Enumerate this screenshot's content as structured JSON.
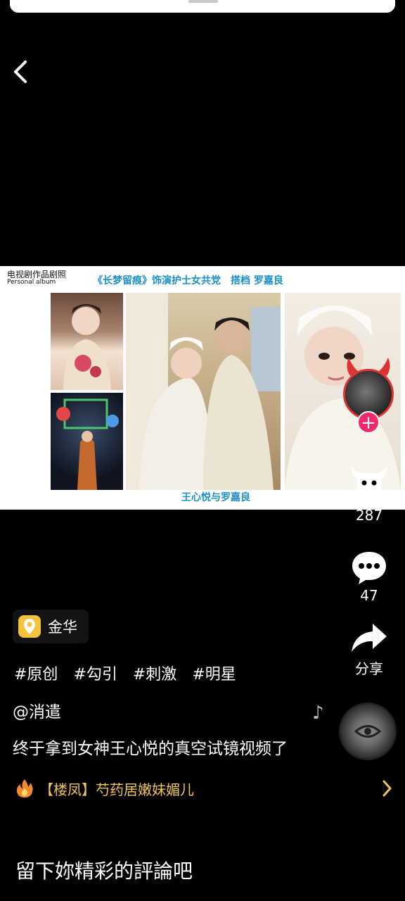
{
  "top_sheet": {},
  "video": {
    "album_label_cn": "电视剧作品剧照",
    "album_label_en": "Personal album",
    "title": "《长梦留痕》饰演护士女共党　搭档 罗嘉良",
    "caption": "王心悦与罗嘉良"
  },
  "actions": {
    "like_count": "287",
    "comment_count": "47",
    "share_label": "分享"
  },
  "info": {
    "location": "金华",
    "tags": [
      "#原创",
      "#勾引",
      "#刺激",
      "#明星"
    ],
    "author": "@消遣",
    "description": "终于拿到女神王心悦的真空试镜视频了",
    "promo": "【楼凤】芍药居嫩妹媚儿"
  },
  "comment_input": {
    "placeholder": "留下妳精彩的評論吧"
  },
  "colors": {
    "accent_pink": "#ee2a6a",
    "promo_gold": "#f0c45a",
    "caption_blue": "#1a8fc8",
    "location_yellow": "#f5c33b"
  }
}
